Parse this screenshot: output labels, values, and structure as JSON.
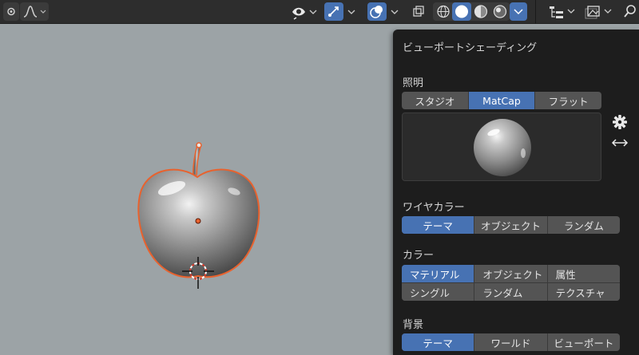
{
  "header": {
    "icons": [
      "dot-icon",
      "falloff-curve-icon",
      "eye-icon",
      "gizmo-icon",
      "overlay-icon",
      "xray-icon",
      "wireframe-shading-icon",
      "solid-shading-icon",
      "material-shading-icon",
      "rendered-shading-icon",
      "outliner-icon",
      "image-icon",
      "search-icon"
    ]
  },
  "panel": {
    "title": "ビューポートシェーディング",
    "lighting": {
      "label": "照明",
      "options": [
        "スタジオ",
        "MatCap",
        "フラット"
      ],
      "active": 1
    },
    "wire_color": {
      "label": "ワイヤカラー",
      "options": [
        "テーマ",
        "オブジェクト",
        "ランダム"
      ],
      "active": 0
    },
    "color": {
      "label": "カラー",
      "options": [
        "マテリアル",
        "オブジェクト",
        "属性",
        "シングル",
        "ランダム",
        "テクスチャ"
      ],
      "active": 0
    },
    "background": {
      "label": "背景",
      "options": [
        "テーマ",
        "ワールド",
        "ビューポート"
      ],
      "active": 0
    }
  },
  "colors": {
    "accent": "#4772b3",
    "viewport_bg": "#9ca3a6",
    "selection_outline": "#e8622e"
  }
}
